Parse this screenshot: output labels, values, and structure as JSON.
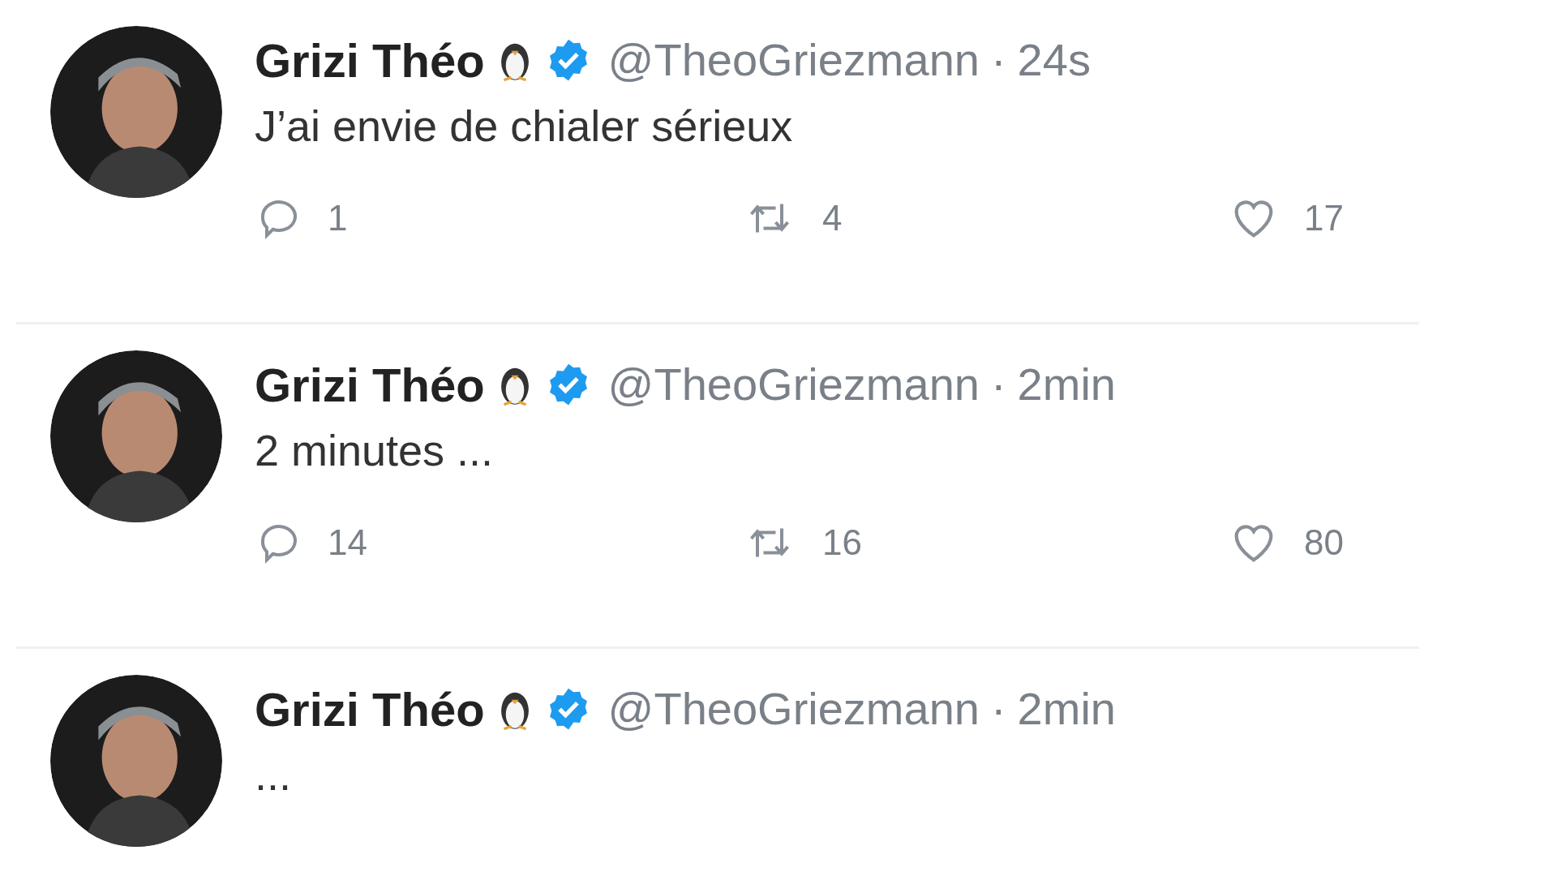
{
  "tweets": [
    {
      "name": "Grizi Théo",
      "handle": "@TheoGriezmann",
      "separator": "·",
      "time": "24s",
      "text": "J’ai envie de chialer sérieux",
      "actions": {
        "replies": "1",
        "retweets": "4",
        "likes": "17"
      }
    },
    {
      "name": "Grizi Théo",
      "handle": "@TheoGriezmann",
      "separator": "·",
      "time": "2min",
      "text": "2 minutes ...",
      "actions": {
        "replies": "14",
        "retweets": "16",
        "likes": "80"
      }
    },
    {
      "name": "Grizi Théo",
      "handle": "@TheoGriezmann",
      "separator": "·",
      "time": "2min",
      "text": "..."
    }
  ]
}
